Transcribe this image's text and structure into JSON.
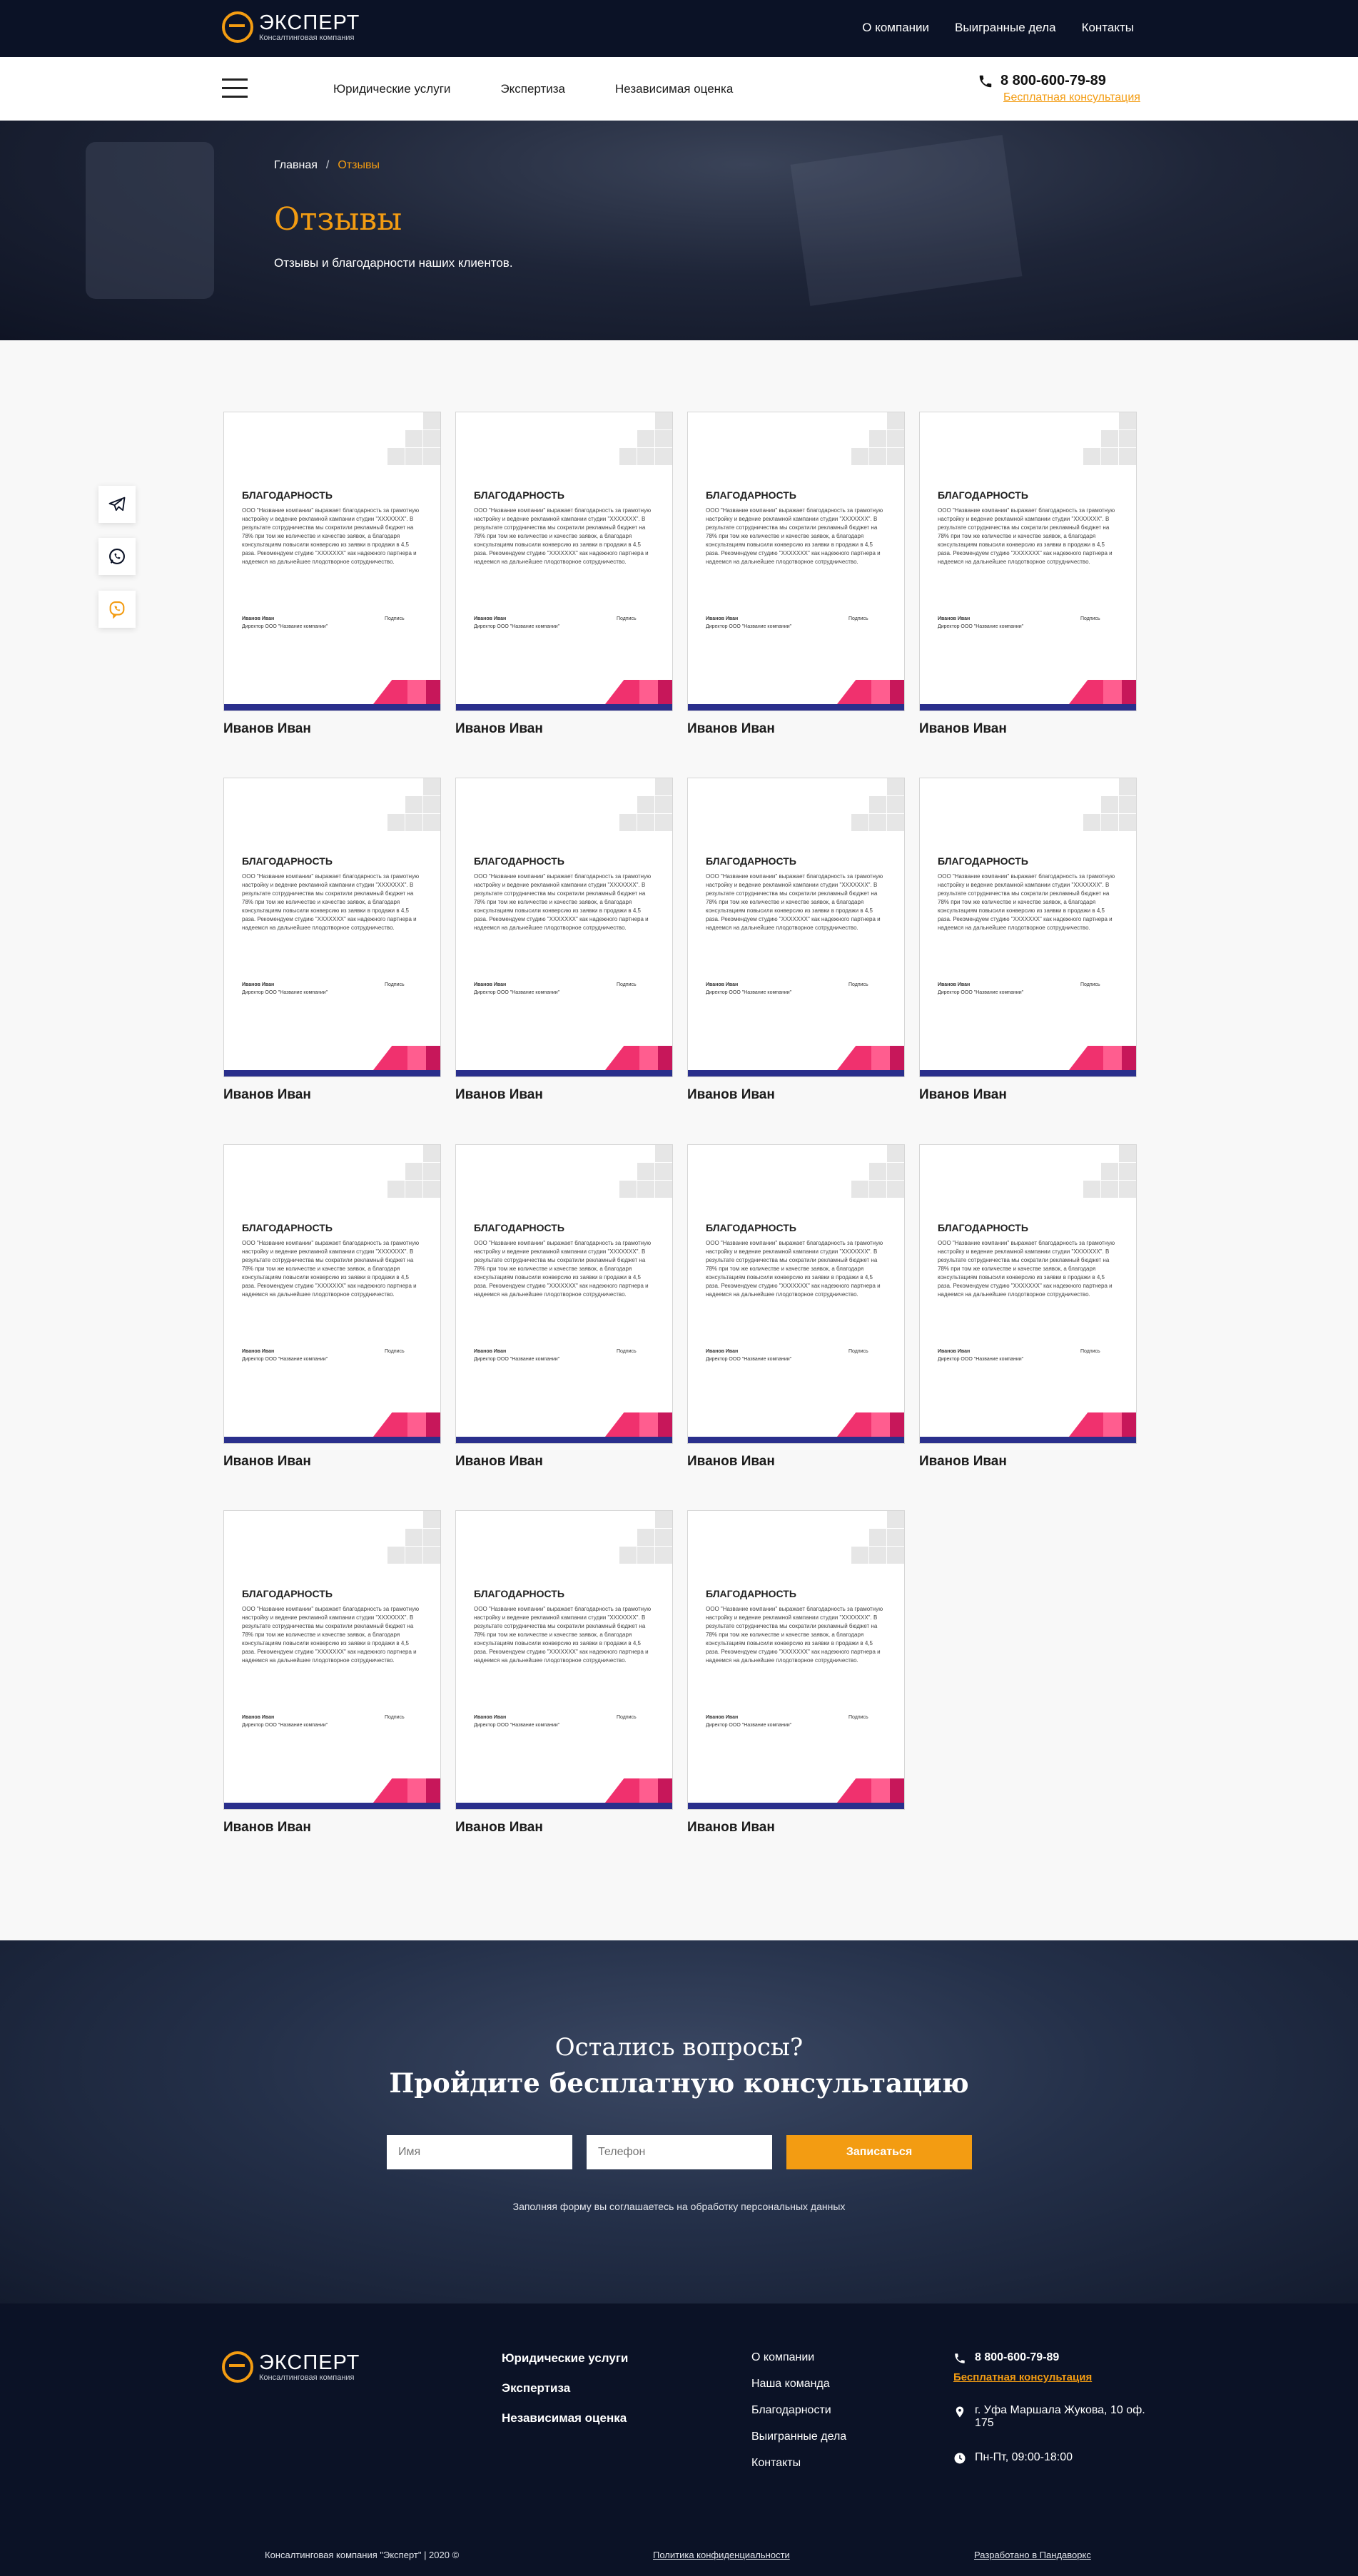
{
  "brand": {
    "name": "ЭКСПЕРТ",
    "tagline": "Консалтинговая компания",
    "accent": "#f39c12",
    "dark": "#0b1226"
  },
  "topnav": [
    "О компании",
    "Выигранные дела",
    "Контакты"
  ],
  "mainnav": [
    "Юридические услуги",
    "Экспертиза",
    "Независимая оценка"
  ],
  "contact": {
    "phone": "8 800-600-79-89",
    "consult": "Бесплатная консультация"
  },
  "breadcrumb": {
    "home": "Главная",
    "separator": "/",
    "current": "Отзывы"
  },
  "hero": {
    "title": "Отзывы",
    "subtitle": "Отзывы и благодарности наших клиентов."
  },
  "side_icons": [
    "telegram-icon",
    "whatsapp-icon",
    "viber-icon"
  ],
  "letter": {
    "title": "БЛАГОДАРНОСТЬ",
    "body": "ООО \"Название компании\" выражает благодарность за грамотную настройку и ведение рекламной кампании студии \"XXXXXXX\". В результате сотрудничества мы сократили рекламный бюджет на 78% при том же количестве и качестве заявок, а благодаря консультациям повысили конверсию из заявки в продажи в 4,5 раза. Рекомендуем студию \"XXXXXXX\" как надежного партнера и надеемся на дальнейшее плодотворное сотрудничество.",
    "signer": "Иванов Иван",
    "position": "Директор ООО \"Название компании\"",
    "sign_label": "Подпись"
  },
  "reviews": [
    {
      "name": "Иванов Иван"
    },
    {
      "name": "Иванов Иван"
    },
    {
      "name": "Иванов Иван"
    },
    {
      "name": "Иванов Иван"
    },
    {
      "name": "Иванов Иван"
    },
    {
      "name": "Иванов Иван"
    },
    {
      "name": "Иванов Иван"
    },
    {
      "name": "Иванов Иван"
    },
    {
      "name": "Иванов Иван"
    },
    {
      "name": "Иванов Иван"
    },
    {
      "name": "Иванов Иван"
    },
    {
      "name": "Иванов Иван"
    },
    {
      "name": "Иванов Иван"
    },
    {
      "name": "Иванов Иван"
    },
    {
      "name": "Иванов Иван"
    }
  ],
  "cta": {
    "question": "Остались вопросы?",
    "headline": "Пройдите бесплатную консультацию",
    "name_placeholder": "Имя",
    "phone_placeholder": "Телефон",
    "submit": "Записаться",
    "agreement": "Заполняя форму вы соглашаетесь на обработку персональных данных"
  },
  "footer": {
    "services": [
      "Юридические услуги",
      "Экспертиза",
      "Независимая оценка"
    ],
    "links": [
      "О компании",
      "Наша команда",
      "Благодарности",
      "Выигранные дела",
      "Контакты"
    ],
    "phone": "8 800-600-79-89",
    "consult": "Бесплатная консультация",
    "address": "г. Уфа Маршала Жукова, 10 оф. 175",
    "hours": "Пн-Пт, 09:00-18:00",
    "copyright": "Консалтинговая компания \"Эксперт\" | 2020 ©",
    "privacy": "Политика конфиденциальности",
    "developer": "Разработано в Пандаворкс"
  }
}
